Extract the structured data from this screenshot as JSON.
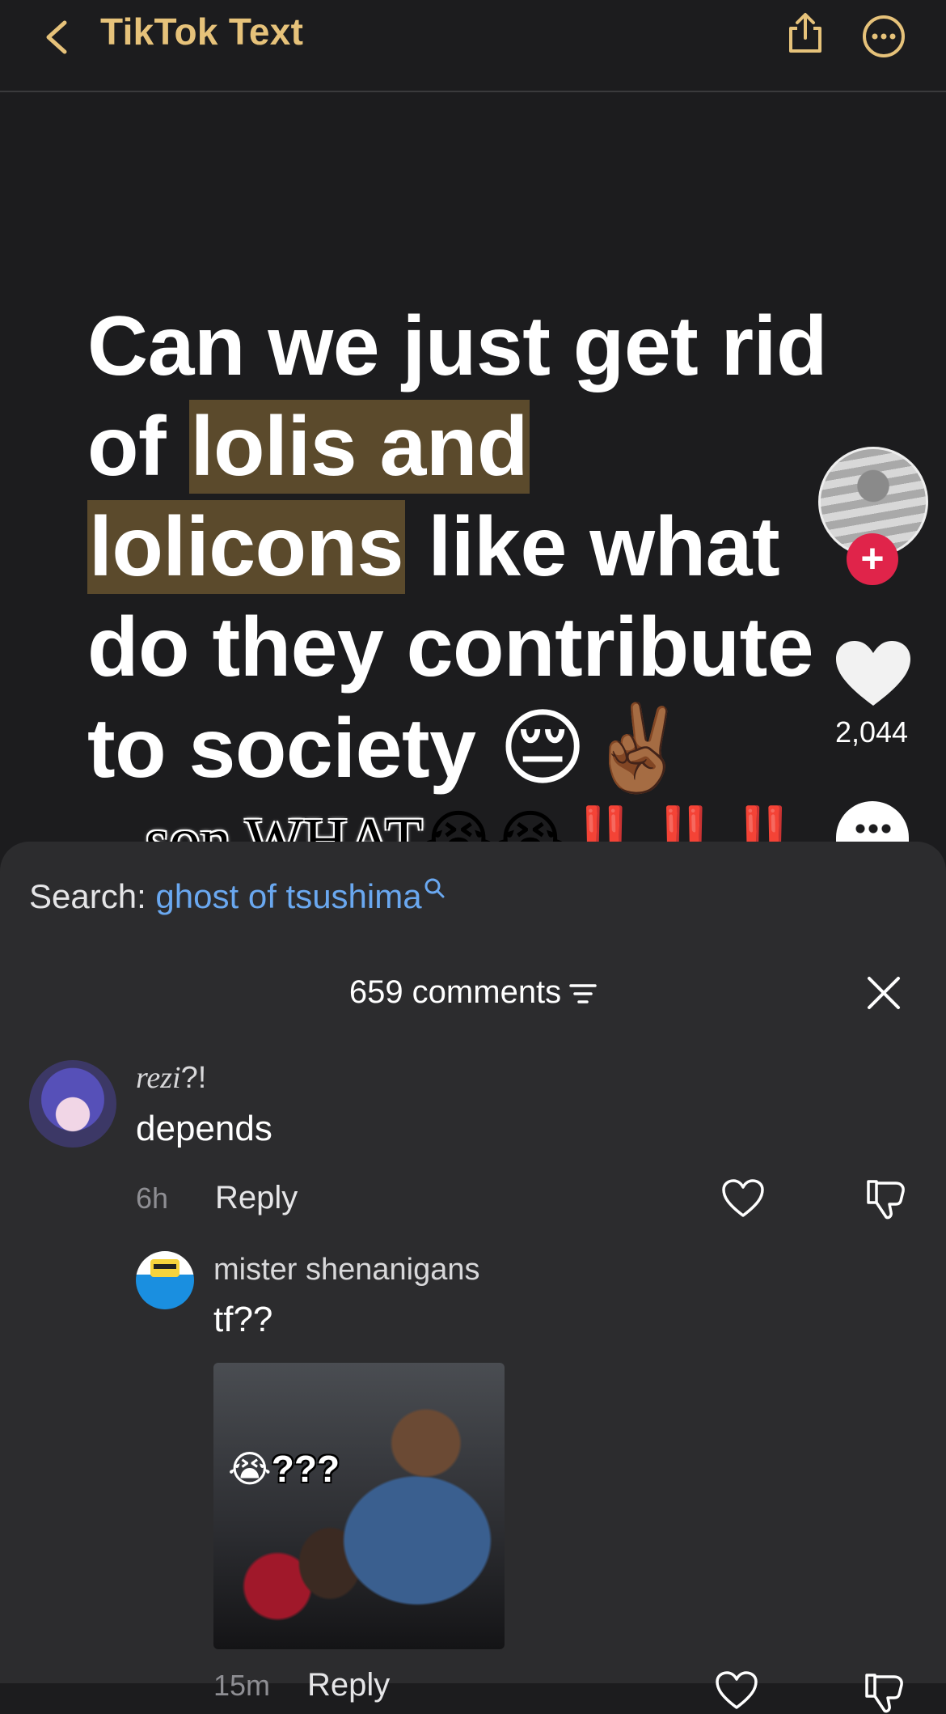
{
  "header": {
    "title": "TikTok Text",
    "back_icon": "chevron-left-icon",
    "share_icon": "share-icon",
    "more_icon": "more-icon",
    "accent_color": "#e6c27a"
  },
  "post": {
    "text_part1": "Can we just get rid of ",
    "highlight1": "lolis and",
    "highlight2": "lolicons",
    "text_part2": " like what do they contribute to society ",
    "emojis": "😔✌🏾",
    "overlay_caption": "son WHAT",
    "overlay_emojis": "😭😭",
    "overlay_bangs": "‼️‼️‼️"
  },
  "side_actions": {
    "like_count": "2,044",
    "follow_symbol": "+"
  },
  "comments_panel": {
    "search_label": "Search:",
    "search_term": "ghost of tsushima",
    "comment_count_label": "659 comments",
    "comments": [
      {
        "username_script": "rezi",
        "username_suffix": "?!",
        "text": "depends",
        "time": "6h",
        "reply_label": "Reply"
      }
    ],
    "replies": [
      {
        "username": "mister shenanigans",
        "text": "tf??",
        "image_caption": "???",
        "image_emoji": "😭",
        "time": "15m",
        "reply_label": "Reply"
      }
    ]
  }
}
